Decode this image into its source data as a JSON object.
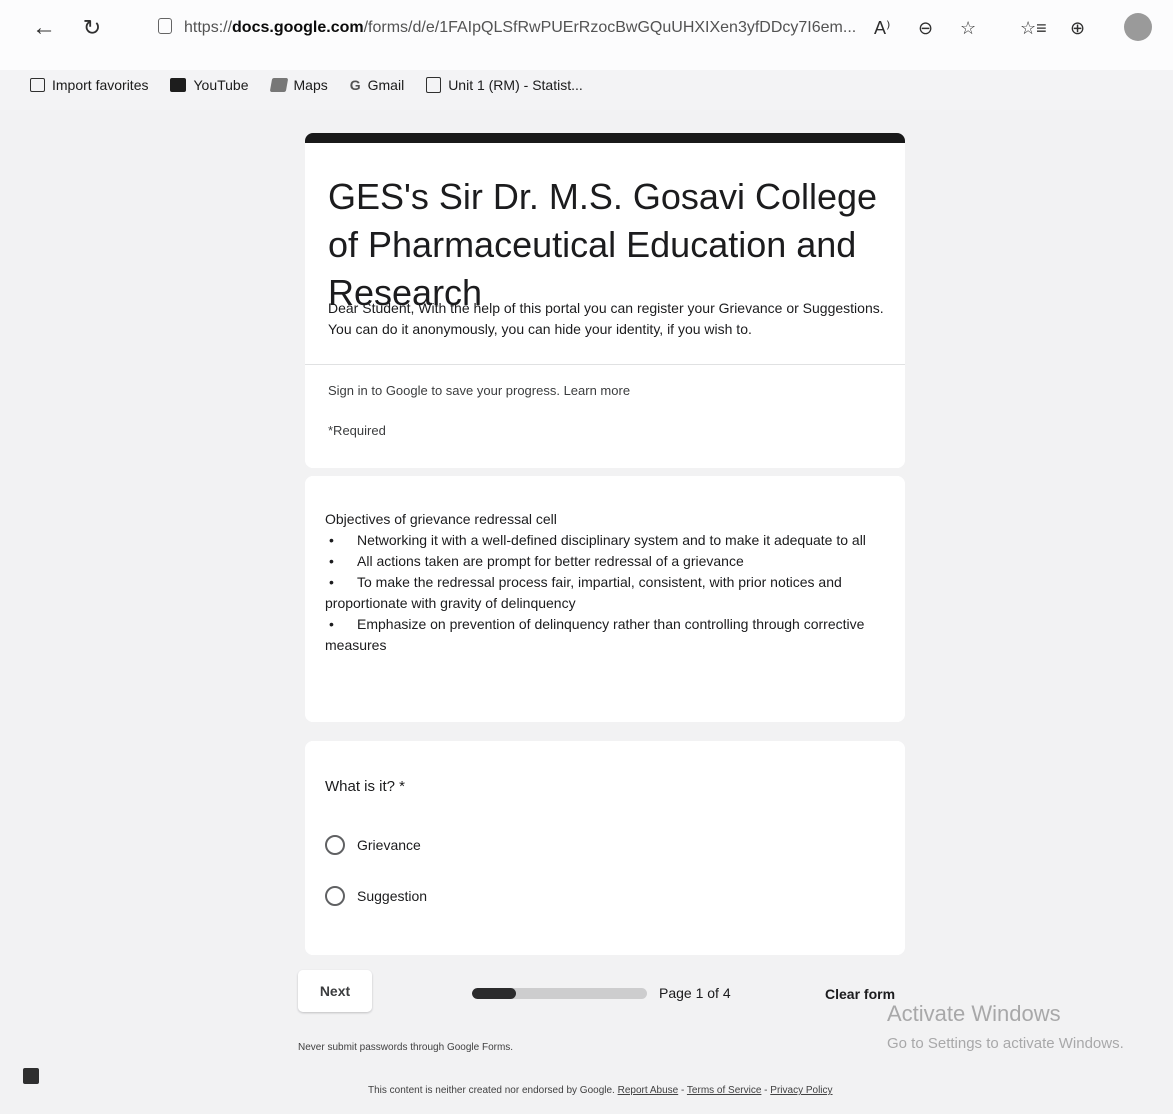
{
  "browser": {
    "url_prefix": "https://",
    "url_domain": "docs.google.com",
    "url_path": "/forms/d/e/1FAIpQLSfRwPUErRzocBwGQuUHXIXen3yfDDcy7I6em...",
    "bookmarks": [
      {
        "label": "Import favorites",
        "icon": "import-icon"
      },
      {
        "label": "YouTube",
        "icon": "youtube-icon"
      },
      {
        "label": "Maps",
        "icon": "maps-icon"
      },
      {
        "label": "Gmail",
        "icon": "gmail-icon"
      },
      {
        "label": "Unit 1 (RM) - Statist...",
        "icon": "document-icon"
      }
    ]
  },
  "form": {
    "title": "GES's Sir Dr. M.S. Gosavi College of Pharmaceutical Education and Research",
    "description": "Dear Student, With the help of this portal you can register your Grievance or Suggestions. You can do it anonymously, you can hide your identity, if you wish to.",
    "signin_text": "Sign in to Google to save your progress. Learn more",
    "required_note": "*Required",
    "objectives_heading": "Objectives of grievance redressal cell",
    "objectives": [
      "Networking it with a well-defined disciplinary system and to make it adequate to all",
      "All actions taken are prompt for better redressal of a grievance",
      "To make the redressal process fair, impartial, consistent, with prior notices and proportionate with gravity of delinquency",
      "Emphasize on prevention of delinquency rather than controlling through corrective measures"
    ],
    "bullet": "•",
    "question": "What is it? *",
    "options": [
      "Grievance",
      "Suggestion"
    ],
    "next_label": "Next",
    "page_label": "Page 1 of 4",
    "progress_fraction": 0.25,
    "clear_label": "Clear form",
    "never_submit": "Never submit passwords through Google Forms.",
    "footer_text": "This content is neither created nor endorsed by Google.",
    "footer_links": [
      "Report Abuse",
      "Terms of Service",
      "Privacy Policy"
    ],
    "footer_sep": " - "
  },
  "watermark": {
    "line1": "Activate Windows",
    "line2": "Go to Settings to activate Windows."
  }
}
